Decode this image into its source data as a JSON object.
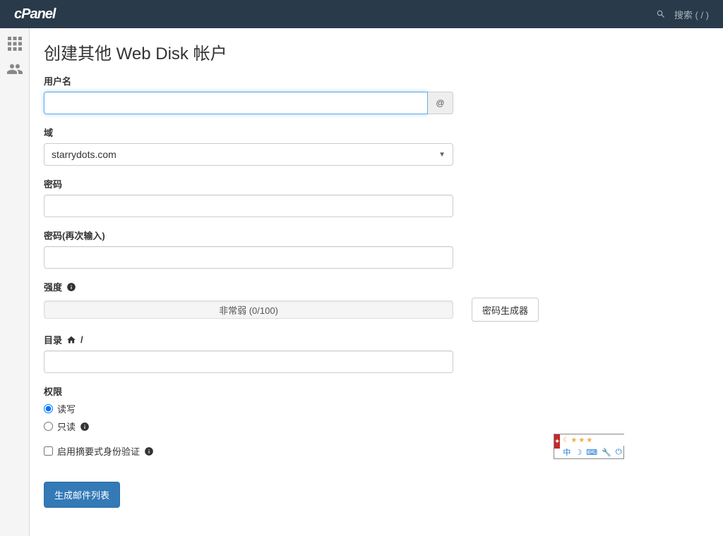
{
  "header": {
    "logo": "cPanel",
    "search_placeholder": "搜索 ( / )"
  },
  "page": {
    "title": "创建其他 Web Disk 帐户"
  },
  "form": {
    "username_label": "用户名",
    "username_value": "",
    "at_symbol": "@",
    "domain_label": "域",
    "domain_value": "starrydots.com",
    "password_label": "密码",
    "password_value": "",
    "password_confirm_label": "密码(再次输入)",
    "password_confirm_value": "",
    "strength_label": "强度",
    "strength_text": "非常弱 (0/100)",
    "password_generator_label": "密码生成器",
    "directory_label": "目录",
    "directory_slash": "/",
    "directory_value": "",
    "permissions_label": "权限",
    "perm_readwrite": "读写",
    "perm_readonly": "只读",
    "digest_auth_label": "启用摘要式身份验证",
    "submit_label": "生成邮件列表"
  },
  "ime": {
    "char": "中"
  }
}
